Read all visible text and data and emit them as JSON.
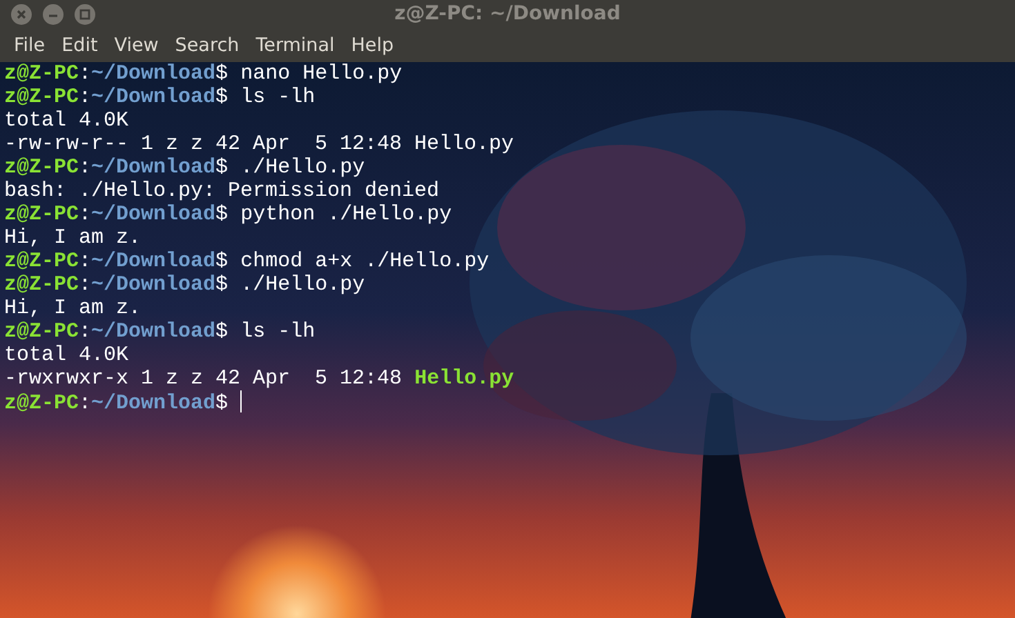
{
  "window": {
    "title": "z@Z-PC: ~/Download"
  },
  "menu": [
    "File",
    "Edit",
    "View",
    "Search",
    "Terminal",
    "Help"
  ],
  "terminal": {
    "lines": [
      {
        "kind": "prompt",
        "user": "z@Z-PC",
        "separator": ":",
        "path": "~/Download",
        "symbol": "$",
        "command": "nano Hello.py"
      },
      {
        "kind": "prompt",
        "user": "z@Z-PC",
        "separator": ":",
        "path": "~/Download",
        "symbol": "$",
        "command": "ls -lh"
      },
      {
        "kind": "output",
        "text": "total 4.0K"
      },
      {
        "kind": "output",
        "text": "-rw-rw-r-- 1 z z 42 Apr  5 12:48 Hello.py"
      },
      {
        "kind": "prompt",
        "user": "z@Z-PC",
        "separator": ":",
        "path": "~/Download",
        "symbol": "$",
        "command": "./Hello.py"
      },
      {
        "kind": "output",
        "text": "bash: ./Hello.py: Permission denied"
      },
      {
        "kind": "prompt",
        "user": "z@Z-PC",
        "separator": ":",
        "path": "~/Download",
        "symbol": "$",
        "command": "python ./Hello.py"
      },
      {
        "kind": "output",
        "text": "Hi, I am z."
      },
      {
        "kind": "prompt",
        "user": "z@Z-PC",
        "separator": ":",
        "path": "~/Download",
        "symbol": "$",
        "command": "chmod a+x ./Hello.py"
      },
      {
        "kind": "prompt",
        "user": "z@Z-PC",
        "separator": ":",
        "path": "~/Download",
        "symbol": "$",
        "command": "./Hello.py"
      },
      {
        "kind": "output",
        "text": "Hi, I am z."
      },
      {
        "kind": "prompt",
        "user": "z@Z-PC",
        "separator": ":",
        "path": "~/Download",
        "symbol": "$",
        "command": "ls -lh"
      },
      {
        "kind": "output",
        "text": "total 4.0K"
      },
      {
        "kind": "output",
        "text": "-rwxrwxr-x 1 z z 42 Apr  5 12:48",
        "executable": "Hello.py"
      },
      {
        "kind": "prompt",
        "user": "z@Z-PC",
        "separator": ":",
        "path": "~/Download",
        "symbol": "$",
        "cursor": true
      }
    ]
  }
}
